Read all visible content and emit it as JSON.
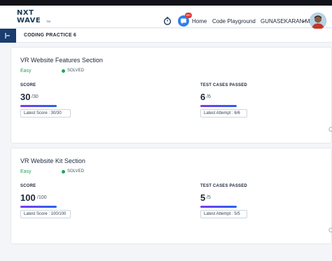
{
  "brand": {
    "line1": "NXT",
    "line2": "WAVE",
    "tm": "TM",
    "color": "#183b56"
  },
  "header": {
    "icons": [
      "timer-icon",
      "chat-icon"
    ],
    "notification_count": "99+",
    "nav": {
      "home": "Home",
      "playground": "Code Playground",
      "user": "GUNASEKARAN M"
    },
    "accent": "#2f80ed"
  },
  "subheader": {
    "title": "CODING PRACTICE 6",
    "toggle_color": "#1a3c6e"
  },
  "cards": [
    {
      "title": "VR Website Features Section",
      "difficulty": "Easy",
      "status": "SOLVED",
      "score_label": "SCORE",
      "score": "30",
      "score_total": "/30",
      "score_fraction": 1.0,
      "latest_score": "Latest Score : 30/30",
      "tests_label": "TEST CASES PASSED",
      "tests": "6",
      "tests_total": "/6",
      "tests_fraction": 1.0,
      "latest_attempt": "Latest Attempt : 6/6"
    },
    {
      "title": "VR Website Kit Section",
      "difficulty": "Easy",
      "status": "SOLVED",
      "score_label": "SCORE",
      "score": "100",
      "score_total": "/100",
      "score_fraction": 1.0,
      "latest_score": "Latest Score : 100/100",
      "tests_label": "TEST CASES PASSED",
      "tests": "5",
      "tests_total": "/5",
      "tests_fraction": 1.0,
      "latest_attempt": "Latest Attempt : 5/5"
    }
  ],
  "colors": {
    "solved": "#22a45d",
    "bar_start": "#7c3aed",
    "bar_end": "#2563eb"
  }
}
